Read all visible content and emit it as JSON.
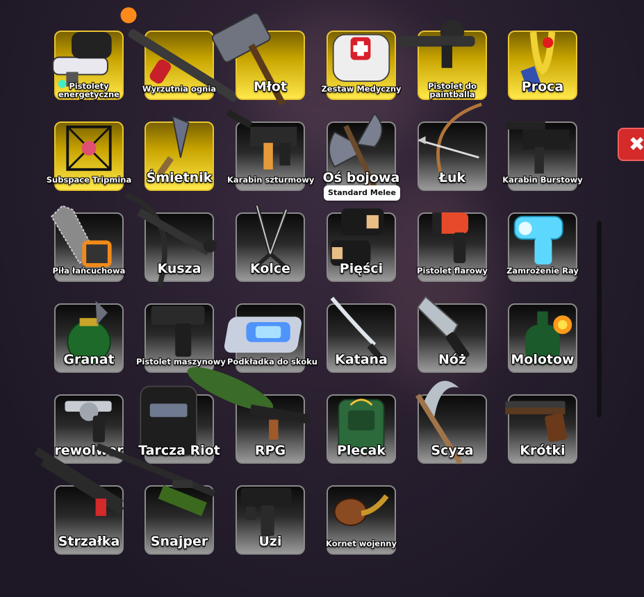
{
  "tooltip": "Standard Melee",
  "close_icon": "close-icon",
  "colors": {
    "gold_tile": "#e9c430",
    "default_tile": "#8a8a8a",
    "close_red": "#d42a2a"
  },
  "items": [
    {
      "label": "Pistolety energetyczne",
      "rarity": "gold",
      "icon": "energy-pistol-icon"
    },
    {
      "label": "Wyrzutnia ognia",
      "rarity": "gold",
      "icon": "flamethrower-icon"
    },
    {
      "label": "Młot",
      "rarity": "gold",
      "icon": "hammer-icon"
    },
    {
      "label": "Zestaw Medyczny",
      "rarity": "gold",
      "icon": "medkit-icon"
    },
    {
      "label": "Pistolet do paintballa",
      "rarity": "gold",
      "icon": "paintball-gun-icon"
    },
    {
      "label": "Proca",
      "rarity": "gold",
      "icon": "slingshot-icon"
    },
    {
      "label": "Subspace Tripmina",
      "rarity": "gold",
      "icon": "tripmine-icon"
    },
    {
      "label": "Śmietnik",
      "rarity": "gold",
      "icon": "trowel-icon"
    },
    {
      "label": "Karabin szturmowy",
      "rarity": "normal",
      "icon": "assault-rifle-icon"
    },
    {
      "label": "Oś bojowa",
      "rarity": "normal",
      "icon": "battle-axe-icon"
    },
    {
      "label": "Łuk",
      "rarity": "normal",
      "icon": "bow-icon"
    },
    {
      "label": "Karabin Burstowy",
      "rarity": "normal",
      "icon": "burst-rifle-icon"
    },
    {
      "label": "Piła łańcuchowa",
      "rarity": "normal",
      "icon": "chainsaw-icon"
    },
    {
      "label": "Kusza",
      "rarity": "normal",
      "icon": "crossbow-icon"
    },
    {
      "label": "Kolce",
      "rarity": "normal",
      "icon": "spikes-icon"
    },
    {
      "label": "Pięści",
      "rarity": "normal",
      "icon": "fists-icon"
    },
    {
      "label": "Pistolet flarowy",
      "rarity": "normal",
      "icon": "flare-gun-icon"
    },
    {
      "label": "Zamrożenie Ray",
      "rarity": "normal",
      "icon": "freeze-ray-icon"
    },
    {
      "label": "Granat",
      "rarity": "normal",
      "icon": "grenade-icon"
    },
    {
      "label": "Pistolet maszynowy",
      "rarity": "normal",
      "icon": "machine-pistol-icon"
    },
    {
      "label": "Podkładka do skoku",
      "rarity": "normal",
      "icon": "jump-pad-icon"
    },
    {
      "label": "Katana",
      "rarity": "normal",
      "icon": "katana-icon"
    },
    {
      "label": "Nóż",
      "rarity": "normal",
      "icon": "knife-icon"
    },
    {
      "label": "Molotow",
      "rarity": "normal",
      "icon": "molotov-icon"
    },
    {
      "label": "rewolwer",
      "rarity": "normal",
      "icon": "revolver-icon"
    },
    {
      "label": "Tarcza Riot",
      "rarity": "normal",
      "icon": "riot-shield-icon"
    },
    {
      "label": "RPG",
      "rarity": "normal",
      "icon": "rpg-icon"
    },
    {
      "label": "Plecak",
      "rarity": "normal",
      "icon": "backpack-icon"
    },
    {
      "label": "Scyza",
      "rarity": "normal",
      "icon": "scythe-icon"
    },
    {
      "label": "Krótki",
      "rarity": "normal",
      "icon": "shotgun-icon"
    },
    {
      "label": "Strzałka",
      "rarity": "normal",
      "icon": "double-barrel-icon"
    },
    {
      "label": "Snajper",
      "rarity": "normal",
      "icon": "sniper-icon"
    },
    {
      "label": "Uzi",
      "rarity": "normal",
      "icon": "uzi-icon"
    },
    {
      "label": "Kornet wojenny",
      "rarity": "normal",
      "icon": "war-horn-icon"
    }
  ]
}
